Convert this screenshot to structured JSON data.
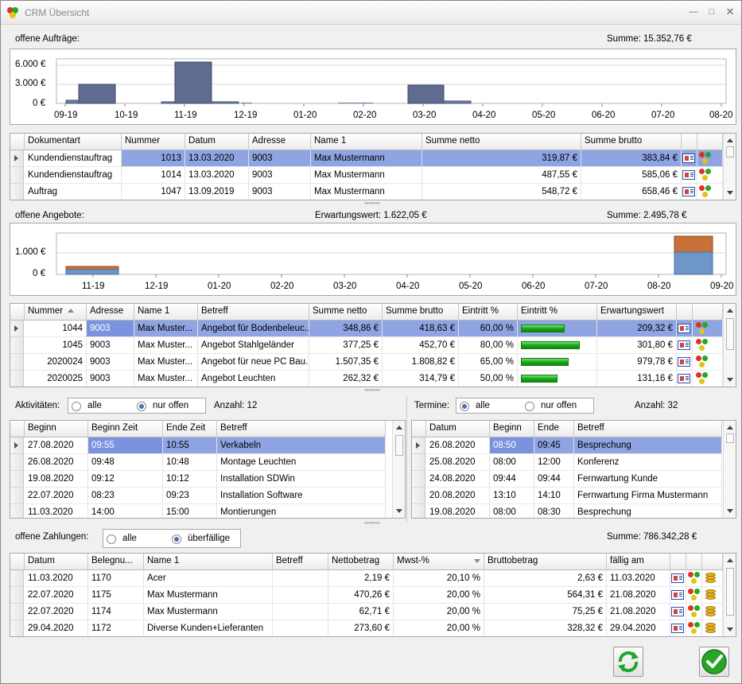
{
  "window": {
    "title": "CRM Übersicht"
  },
  "auftraege": {
    "label": "offene Aufträge:",
    "summe": "Summe: 15.352,76 €",
    "chart": {
      "type": "bar",
      "y_ticks": [
        "6.000 €",
        "3.000 €",
        "0 €"
      ],
      "x_ticks": [
        "09-19",
        "10-19",
        "11-19",
        "12-19",
        "01-20",
        "02-20",
        "03-20",
        "04-20",
        "05-20",
        "06-20",
        "07-20",
        "08-20"
      ]
    },
    "columns": [
      "Dokumentart",
      "Nummer",
      "Datum",
      "Adresse",
      "Name 1",
      "Summe netto",
      "Summe brutto"
    ],
    "rows": [
      [
        "Kundendienstauftrag",
        "1013",
        "13.03.2020",
        "9003",
        "Max Mustermann",
        "319,87 €",
        "383,84 €"
      ],
      [
        "Kundendienstauftrag",
        "1014",
        "13.03.2020",
        "9003",
        "Max Mustermann",
        "487,55 €",
        "585,06 €"
      ],
      [
        "Auftrag",
        "1047",
        "13.09.2019",
        "9003",
        "Max Mustermann",
        "548,72 €",
        "658,46 €"
      ]
    ]
  },
  "angebote": {
    "label": "offene Angebote:",
    "erwartung": "Erwartungswert: 1.622,05 €",
    "summe": "Summe: 2.495,78 €",
    "chart": {
      "type": "bar",
      "y_ticks": [
        "1.000 €",
        "0 €"
      ],
      "x_ticks": [
        "11-19",
        "12-19",
        "01-20",
        "02-20",
        "03-20",
        "04-20",
        "05-20",
        "06-20",
        "07-20",
        "08-20",
        "09-20"
      ]
    },
    "columns": [
      "Nummer",
      "Adresse",
      "Name 1",
      "Betreff",
      "Summe netto",
      "Summe brutto",
      "Eintritt %",
      "Eintritt %",
      "Erwartungswert"
    ],
    "rows": [
      {
        "cells": [
          "1044",
          "9003",
          "Max Muster...",
          "Angebot für Bodenbeleuc...",
          "348,86 €",
          "418,63 €",
          "60,00 %",
          "209,32 €"
        ],
        "progress": 0.6
      },
      {
        "cells": [
          "1045",
          "9003",
          "Max Muster...",
          "Angebot Stahlgeländer",
          "377,25 €",
          "452,70 €",
          "80,00 %",
          "301,80 €"
        ],
        "progress": 0.8
      },
      {
        "cells": [
          "2020024",
          "9003",
          "Max Muster...",
          "Angebot für neue PC Bau...",
          "1.507,35 €",
          "1.808,82 €",
          "65,00 %",
          "979,78 €"
        ],
        "progress": 0.65
      },
      {
        "cells": [
          "2020025",
          "9003",
          "Max Muster...",
          "Angebot Leuchten",
          "262,32 €",
          "314,79 €",
          "50,00 %",
          "131,16 €"
        ],
        "progress": 0.5
      }
    ]
  },
  "aktivitaeten": {
    "label": "Aktivitäten:",
    "opt_all": "alle",
    "opt_open": "nur offen",
    "anzahl": "Anzahl: 12",
    "columns": [
      "Beginn",
      "Beginn Zeit",
      "Ende Zeit",
      "Betreff"
    ],
    "rows": [
      [
        "27.08.2020",
        "09:55",
        "10:55",
        "Verkabeln"
      ],
      [
        "26.08.2020",
        "09:48",
        "10:48",
        "Montage Leuchten"
      ],
      [
        "19.08.2020",
        "09:12",
        "10:12",
        "Installation SDWin"
      ],
      [
        "22.07.2020",
        "08:23",
        "09:23",
        "Installation Software"
      ],
      [
        "11.03.2020",
        "14:00",
        "15:00",
        "Montierungen"
      ]
    ]
  },
  "termine": {
    "label": "Termine:",
    "opt_all": "alle",
    "opt_open": "nur offen",
    "anzahl": "Anzahl: 32",
    "columns": [
      "Datum",
      "Beginn",
      "Ende",
      "Betreff"
    ],
    "rows": [
      [
        "26.08.2020",
        "08:50",
        "09:45",
        "Besprechung"
      ],
      [
        "25.08.2020",
        "08:00",
        "12:00",
        "Konferenz"
      ],
      [
        "24.08.2020",
        "09:44",
        "09:44",
        "Fernwartung Kunde"
      ],
      [
        "20.08.2020",
        "13:10",
        "14:10",
        "Fernwartung Firma Mustermann"
      ],
      [
        "19.08.2020",
        "08:00",
        "08:30",
        "Besprechung"
      ]
    ]
  },
  "zahlungen": {
    "label": "offene Zahlungen:",
    "opt_all": "alle",
    "opt_due": "überfällige",
    "summe": "Summe: 786.342,28 €",
    "columns": [
      "Datum",
      "Belegnu...",
      "Name 1",
      "Betreff",
      "Nettobetrag",
      "Mwst-%",
      "Bruttobetrag",
      "fällig am"
    ],
    "rows": [
      [
        "11.03.2020",
        "1170",
        "Acer",
        "",
        "2,19 €",
        "20,10 %",
        "2,63 €",
        "11.03.2020"
      ],
      [
        "22.07.2020",
        "1175",
        "Max Mustermann",
        "",
        "470,26 €",
        "20,00 %",
        "564,31 €",
        "21.08.2020"
      ],
      [
        "22.07.2020",
        "1174",
        "Max Mustermann",
        "",
        "62,71 €",
        "20,00 %",
        "75,25 €",
        "21.08.2020"
      ],
      [
        "29.04.2020",
        "1172",
        "Diverse Kunden+Lieferanten",
        "",
        "273,60 €",
        "20,00 %",
        "328,32 €",
        "29.04.2020"
      ]
    ]
  }
}
